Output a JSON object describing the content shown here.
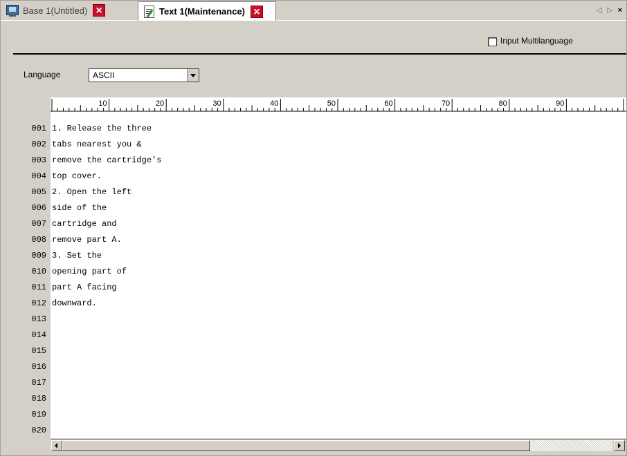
{
  "tabs": [
    {
      "label": "Base 1(Untitled)",
      "icon": "monitor-icon",
      "active": false
    },
    {
      "label": "Text 1(Maintenance)",
      "icon": "text-document-icon",
      "active": true
    }
  ],
  "nav_arrows": "◁ ▷",
  "close_all": "×",
  "multilanguage": {
    "label": "Input Multilanguage",
    "checked": false
  },
  "language": {
    "label": "Language",
    "selected": "ASCII"
  },
  "ruler": {
    "labels": [
      "10",
      "20",
      "30",
      "40",
      "50",
      "60",
      "70",
      "80",
      "90"
    ]
  },
  "lines": [
    {
      "no": "001",
      "text": "1. Release the three"
    },
    {
      "no": "002",
      "text": "tabs nearest you &"
    },
    {
      "no": "003",
      "text": "remove the cartridge's"
    },
    {
      "no": "004",
      "text": "top cover."
    },
    {
      "no": "005",
      "text": "2. Open the left"
    },
    {
      "no": "006",
      "text": "side of the"
    },
    {
      "no": "007",
      "text": "cartridge and"
    },
    {
      "no": "008",
      "text": "remove part A."
    },
    {
      "no": "009",
      "text": "3. Set the"
    },
    {
      "no": "010",
      "text": "opening part of"
    },
    {
      "no": "011",
      "text": "part A facing"
    },
    {
      "no": "012",
      "text": "downward."
    },
    {
      "no": "013",
      "text": ""
    },
    {
      "no": "014",
      "text": ""
    },
    {
      "no": "015",
      "text": ""
    },
    {
      "no": "016",
      "text": ""
    },
    {
      "no": "017",
      "text": ""
    },
    {
      "no": "018",
      "text": ""
    },
    {
      "no": "019",
      "text": ""
    },
    {
      "no": "020",
      "text": ""
    }
  ],
  "colors": {
    "tab_close": "#c8102e",
    "chrome": "#d4d0c8"
  }
}
